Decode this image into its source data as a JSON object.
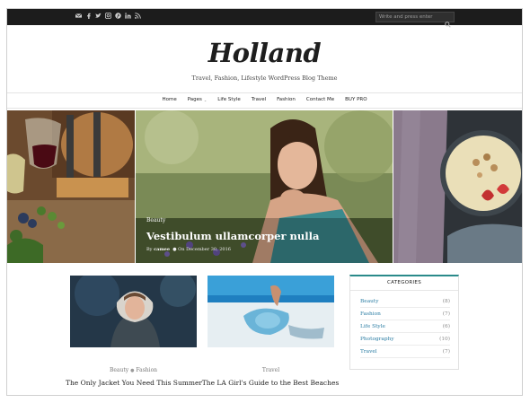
{
  "topbar": {
    "social_icons": [
      "envelope-icon",
      "facebook-icon",
      "twitter-icon",
      "instagram-icon",
      "pinterest-icon",
      "linkedin-icon",
      "rss-icon"
    ],
    "search_placeholder": "Write and press enter"
  },
  "header": {
    "logo": "Holland",
    "tagline": "Travel, Fashion, Lifestyle WordPress Blog Theme"
  },
  "nav": {
    "items": [
      "Home",
      "Pages",
      "Life Style",
      "Travel",
      "Fashion",
      "Contact Me",
      "BUY PRO"
    ]
  },
  "slider": {
    "category": "Beauty",
    "title": "Vestibulum ullamcorper nulla",
    "author_prefix": "By",
    "author": "camee",
    "date_prefix": "On",
    "date": "December 30, 2016"
  },
  "posts": [
    {
      "categories": [
        "Beauty",
        "Fashion"
      ],
      "title": "The Only Jacket You Need This Summer"
    },
    {
      "categories": [
        "Travel"
      ],
      "title": "The LA Girl's Guide to the Best Beaches"
    }
  ],
  "widget": {
    "title": "CATEGORIES",
    "items": [
      {
        "name": "Beauty",
        "count": "(8)"
      },
      {
        "name": "Fashion",
        "count": "(7)"
      },
      {
        "name": "Life Style",
        "count": "(6)"
      },
      {
        "name": "Photography",
        "count": "(10)"
      },
      {
        "name": "Travel",
        "count": "(7)"
      }
    ]
  },
  "colors": {
    "topbar": "#1c1c1c",
    "accent": "#2a8a8a",
    "link": "#2a7ca3"
  }
}
